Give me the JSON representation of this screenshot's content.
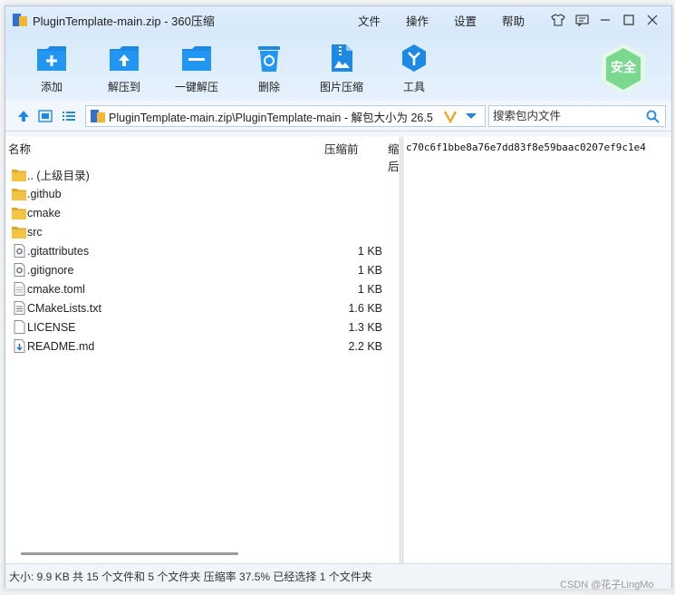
{
  "window": {
    "title": "PluginTemplate-main.zip - 360压缩",
    "menus": [
      "文件",
      "操作",
      "设置",
      "帮助"
    ]
  },
  "toolbar": {
    "tools": [
      {
        "label": "添加",
        "icon": "add-folder-icon"
      },
      {
        "label": "解压到",
        "icon": "extract-to-icon"
      },
      {
        "label": "一键解压",
        "icon": "one-click-extract-icon"
      },
      {
        "label": "删除",
        "icon": "recycle-bin-icon"
      },
      {
        "label": "图片压缩",
        "icon": "image-compress-icon"
      },
      {
        "label": "工具",
        "icon": "tools-icon"
      }
    ],
    "security_badge": "安全"
  },
  "address": {
    "path": "PluginTemplate-main.zip\\PluginTemplate-main - 解包大小为 26.5",
    "search_placeholder": "搜索包内文件"
  },
  "filelist": {
    "columns": {
      "name": "名称",
      "compressed": "压缩前",
      "original": "压缩后"
    },
    "rows": [
      {
        "name": ".. (上级目录)",
        "size": "",
        "icon": "folder-icon"
      },
      {
        "name": ".github",
        "size": "",
        "icon": "folder-icon"
      },
      {
        "name": "cmake",
        "size": "",
        "icon": "folder-icon"
      },
      {
        "name": "src",
        "size": "",
        "icon": "folder-icon"
      },
      {
        "name": ".gitattributes",
        "size": "1 KB",
        "icon": "config-file-icon"
      },
      {
        "name": ".gitignore",
        "size": "1 KB",
        "icon": "config-file-icon"
      },
      {
        "name": "cmake.toml",
        "size": "1 KB",
        "icon": "text-file-icon"
      },
      {
        "name": "CMakeLists.txt",
        "size": "1.6 KB",
        "icon": "text-file-icon"
      },
      {
        "name": "LICENSE",
        "size": "1.3 KB",
        "icon": "blank-file-icon"
      },
      {
        "name": "README.md",
        "size": "2.2 KB",
        "icon": "markdown-file-icon"
      }
    ]
  },
  "comment": "c70c6f1bbe8a76e7dd83f8e59baac0207ef9c1e4",
  "status": "大小: 9.9 KB 共 15 个文件和 5 个文件夹 压缩率 37.5% 已经选择 1 个文件夹",
  "watermark": "CSDN @花子LingMo",
  "colors": {
    "accent": "#1e88e5",
    "folder": "#f5c342",
    "safe": "#7bd88f"
  }
}
